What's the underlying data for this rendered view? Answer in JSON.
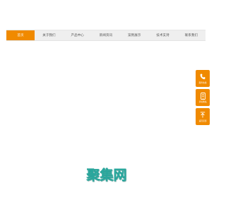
{
  "nav": {
    "items": [
      {
        "label": "首页"
      },
      {
        "label": "关于我们"
      },
      {
        "label": "产品中心"
      },
      {
        "label": "新闻资讯"
      },
      {
        "label": "案例展示"
      },
      {
        "label": "技术支持"
      },
      {
        "label": "联系我们"
      }
    ],
    "active_index": 0
  },
  "float_bar": {
    "buttons": [
      {
        "label": "服务热线",
        "icon": "phone-icon"
      },
      {
        "label": "手机网站",
        "icon": "mobile-icon"
      },
      {
        "label": "返回顶部",
        "icon": "back-to-top-icon"
      }
    ]
  },
  "watermark": {
    "text": "聚集网"
  },
  "colors": {
    "accent": "#f08a00",
    "nav_bg": "#efefef",
    "nav_text": "#555555",
    "watermark": "#36b6ac"
  }
}
